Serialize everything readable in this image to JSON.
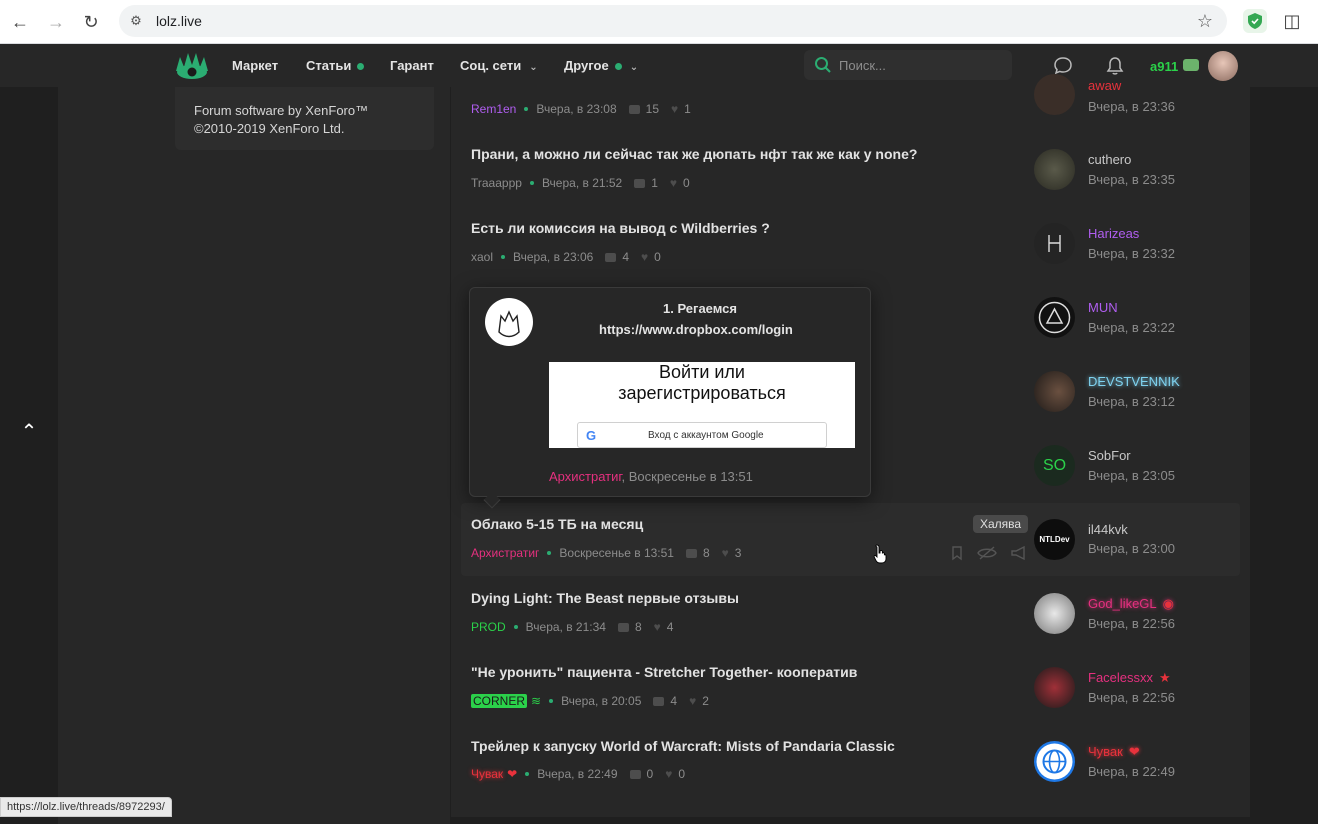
{
  "browser": {
    "url": "lolz.live",
    "status_url": "https://lolz.live/threads/8972293/"
  },
  "nav": {
    "items": [
      {
        "label": "Маркет"
      },
      {
        "label": "Статьи"
      },
      {
        "label": "Гарант"
      },
      {
        "label": "Соц. сети"
      },
      {
        "label": "Другое"
      }
    ],
    "search_placeholder": "Поиск...",
    "username": "a911"
  },
  "footer": {
    "line1": "Forum software by XenForo™",
    "line2": "©2010-2019 XenForo Ltd."
  },
  "threads": [
    {
      "title": "",
      "author": "Rem1en",
      "time": "Вчера, в 23:08",
      "replies": "15",
      "likes": "1"
    },
    {
      "title": "Прани, а можно ли сейчас так же дюпать нфт так же как у none?",
      "author": "Traaappp",
      "time": "Вчера, в 21:52",
      "replies": "1",
      "likes": "0"
    },
    {
      "title": "Есть ли комиссия на вывод с Wildberries ?",
      "author": "xaol",
      "time": "Вчера, в 23:06",
      "replies": "4",
      "likes": "0"
    },
    {
      "title": "Облако 5-15 ТБ на месяц",
      "author": "Архистратиг",
      "time": "Воскресенье в 13:51",
      "replies": "8",
      "likes": "3",
      "prefix": "Халява"
    },
    {
      "title": "Dying Light: The Beast первые отзывы",
      "author": "PROD",
      "time": "Вчера, в 21:34",
      "replies": "8",
      "likes": "4"
    },
    {
      "title": "\"Не уронить\" пациента - Stretcher Together- кооператив",
      "author": "CORNER",
      "time": "Вчера, в 20:05",
      "replies": "4",
      "likes": "2"
    },
    {
      "title": "Трейлер к запуску World of Warcraft: Mists of Pandaria Classic",
      "author": "Чувак",
      "time": "Вчера, в 22:49",
      "replies": "0",
      "likes": "0"
    }
  ],
  "last_posters": [
    {
      "name": "awaw",
      "time": "Вчера, в 23:36"
    },
    {
      "name": "cuthero",
      "time": "Вчера, в 23:35"
    },
    {
      "name": "Harizeas",
      "time": "Вчера, в 23:32"
    },
    {
      "name": "MUN",
      "time": "Вчера, в 23:22"
    },
    {
      "name": "DEVSTVENNIK",
      "time": "Вчера, в 23:12"
    },
    {
      "name": "SobFor",
      "time": "Вчера, в 23:05",
      "avatar_text": "SO"
    },
    {
      "name": "il44kvk",
      "time": "Вчера, в 23:00",
      "avatar_text": "NTLDev"
    },
    {
      "name": "God_likeGL",
      "time": "Вчера, в 22:56"
    },
    {
      "name": "Facelessxx",
      "time": "Вчера, в 22:56"
    },
    {
      "name": "Чувак",
      "time": "Вчера, в 22:49"
    }
  ],
  "preview": {
    "line1": "1. Регаемся",
    "line2": "https://www.dropbox.com/login",
    "img_line1": "Войти или",
    "img_line2": "зарегистрироваться",
    "google_btn": "Вход с аккаунтом Google",
    "author": "Архистратиг",
    "time": ", Воскресенье в 13:51"
  },
  "colors": {
    "accent": "#2bad72",
    "username_green": "#2bd14a",
    "purple": "#b05ef0",
    "pink": "#e5307f",
    "red": "#e8323c",
    "cyan": "#7fd3f0"
  }
}
